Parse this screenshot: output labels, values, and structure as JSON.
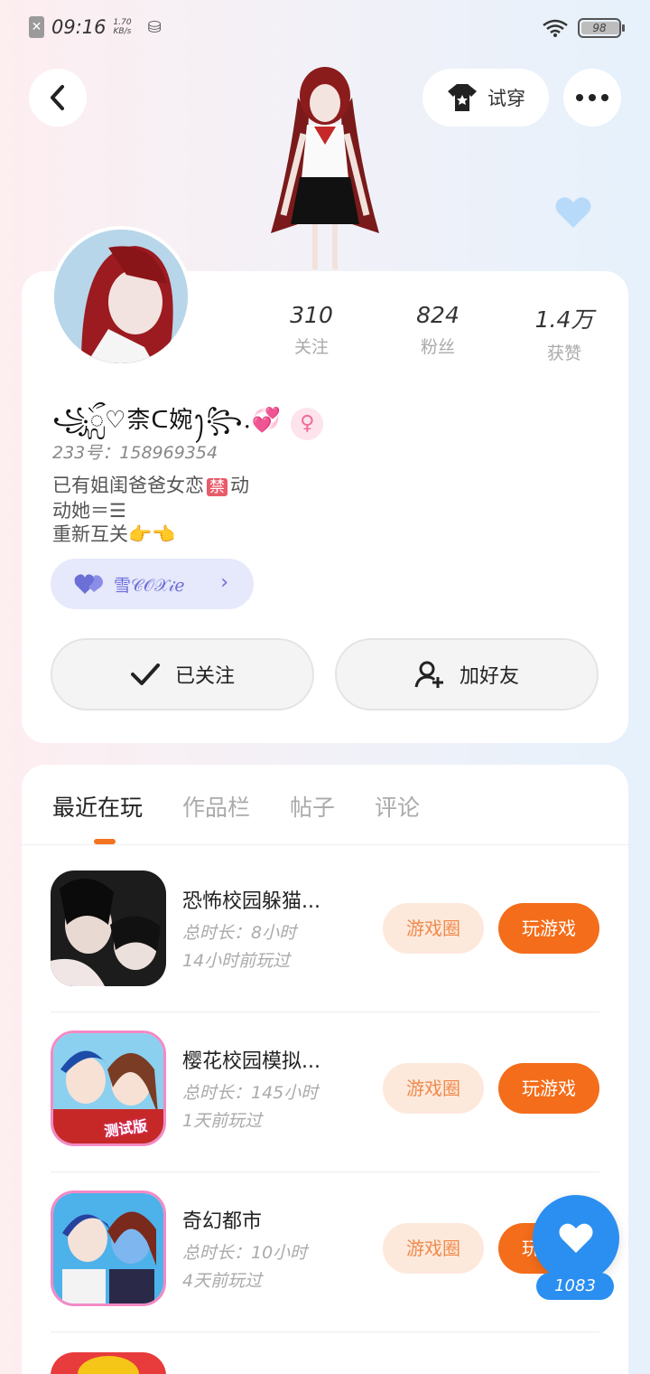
{
  "status_bar": {
    "time": "09:16",
    "speed_value": "1.70",
    "speed_unit": "KB/s",
    "battery": "98"
  },
  "header": {
    "tryon_label": "试穿"
  },
  "profile": {
    "stats": [
      {
        "value": "310",
        "label": "关注"
      },
      {
        "value": "824",
        "label": "粉丝"
      },
      {
        "value": "1.4万",
        "label": "获赞"
      }
    ],
    "nickname": "꧁ᬼ♡柰ᑕ婉ꫂ꧂.💞",
    "gender_symbol": "♀",
    "uid": "233号：158969354",
    "bio_line1": "已有姐闺爸爸女恋",
    "bio_forbid": "禁",
    "bio_line1_end": "动",
    "bio_line2": "动她＝☰",
    "bio_line3": "重新互关👉👈",
    "cp_label": "雪𝒞𝒪𝒳𝒾ℯ"
  },
  "actions": {
    "followed_label": "已关注",
    "add_friend_label": "加好友"
  },
  "tabs": [
    "最近在玩",
    "作品栏",
    "帖子",
    "评论"
  ],
  "games": [
    {
      "title": "恐怖校园躲猫...",
      "duration": "总时长：8小时",
      "last_played": "14小时前玩过",
      "group_label": "游戏圈",
      "play_label": "玩游戏"
    },
    {
      "title": "樱花校园模拟...",
      "duration": "总时长：145小时",
      "last_played": "1天前玩过",
      "group_label": "游戏圈",
      "play_label": "玩游戏",
      "badge": "测试版"
    },
    {
      "title": "奇幻都市",
      "duration": "总时长：10小时",
      "last_played": "4天前玩过",
      "group_label": "游戏圈",
      "play_label": "玩游戏"
    }
  ],
  "float_like": {
    "count": "1083"
  },
  "colors": {
    "accent_orange": "#f46d1a",
    "accent_blue": "#2a8ff0"
  }
}
